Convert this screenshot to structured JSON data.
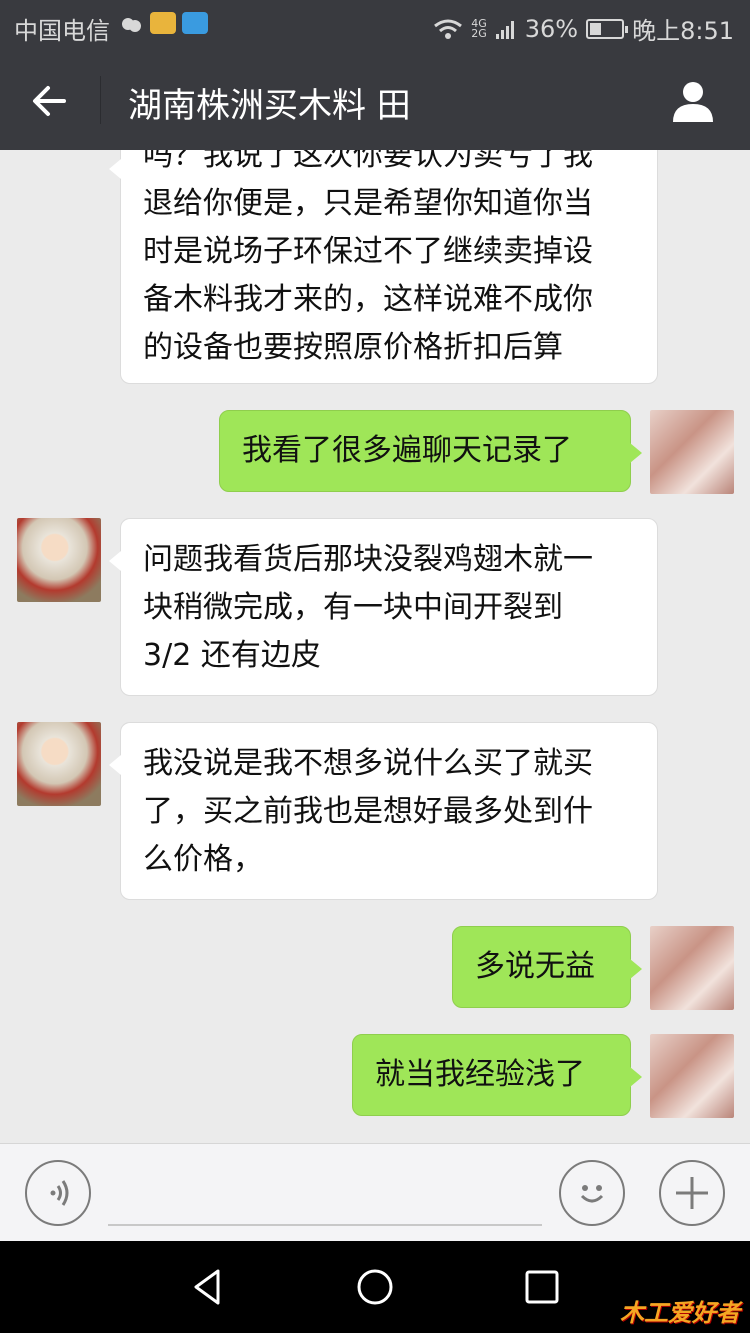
{
  "status_bar": {
    "carrier": "中国电信",
    "network": "4G",
    "network_sub": "2G",
    "battery": "36%",
    "battery_level": 0.36,
    "time": "晚上8:51"
  },
  "header": {
    "title": "湖南株洲买木料 田",
    "back_icon": "arrow-left-icon",
    "profile_icon": "person-icon"
  },
  "messages": [
    {
      "side": "left",
      "text_lines": [
        "吗？我说了这次你要认为卖亏了我",
        "退给你便是，只是希望你知道你当",
        "时是说场子环保过不了继续卖掉设",
        "备木料我才来的，这样说难不成你",
        "的设备也要按照原价格折扣后算"
      ]
    },
    {
      "side": "right",
      "text_lines": [
        "我看了很多遍聊天记录了"
      ]
    },
    {
      "side": "left",
      "text_lines": [
        "问题我看货后那块没裂鸡翅木就一",
        "块稍微完成，有一块中间开裂到",
        "3/2 还有边皮"
      ]
    },
    {
      "side": "left",
      "text_lines": [
        "我没说是我不想多说什么买了就买",
        "了，买之前我也是想好最多处到什",
        "么价格，"
      ]
    },
    {
      "side": "right",
      "text_lines": [
        "多说无益"
      ]
    },
    {
      "side": "right",
      "text_lines": [
        "就当我经验浅了"
      ]
    }
  ],
  "input": {
    "placeholder": "",
    "voice_icon": "voice-icon",
    "emoji_icon": "smiley-icon",
    "more_icon": "plus-icon"
  },
  "system_nav": {
    "back_icon": "triangle-back-icon",
    "home_icon": "circle-home-icon",
    "recents_icon": "square-recents-icon"
  },
  "watermark": "木工爱好者",
  "colors": {
    "header_bg": "#393a3f",
    "chat_bg": "#ebebeb",
    "sent_bubble": "#9fe658",
    "received_bubble": "#ffffff"
  }
}
